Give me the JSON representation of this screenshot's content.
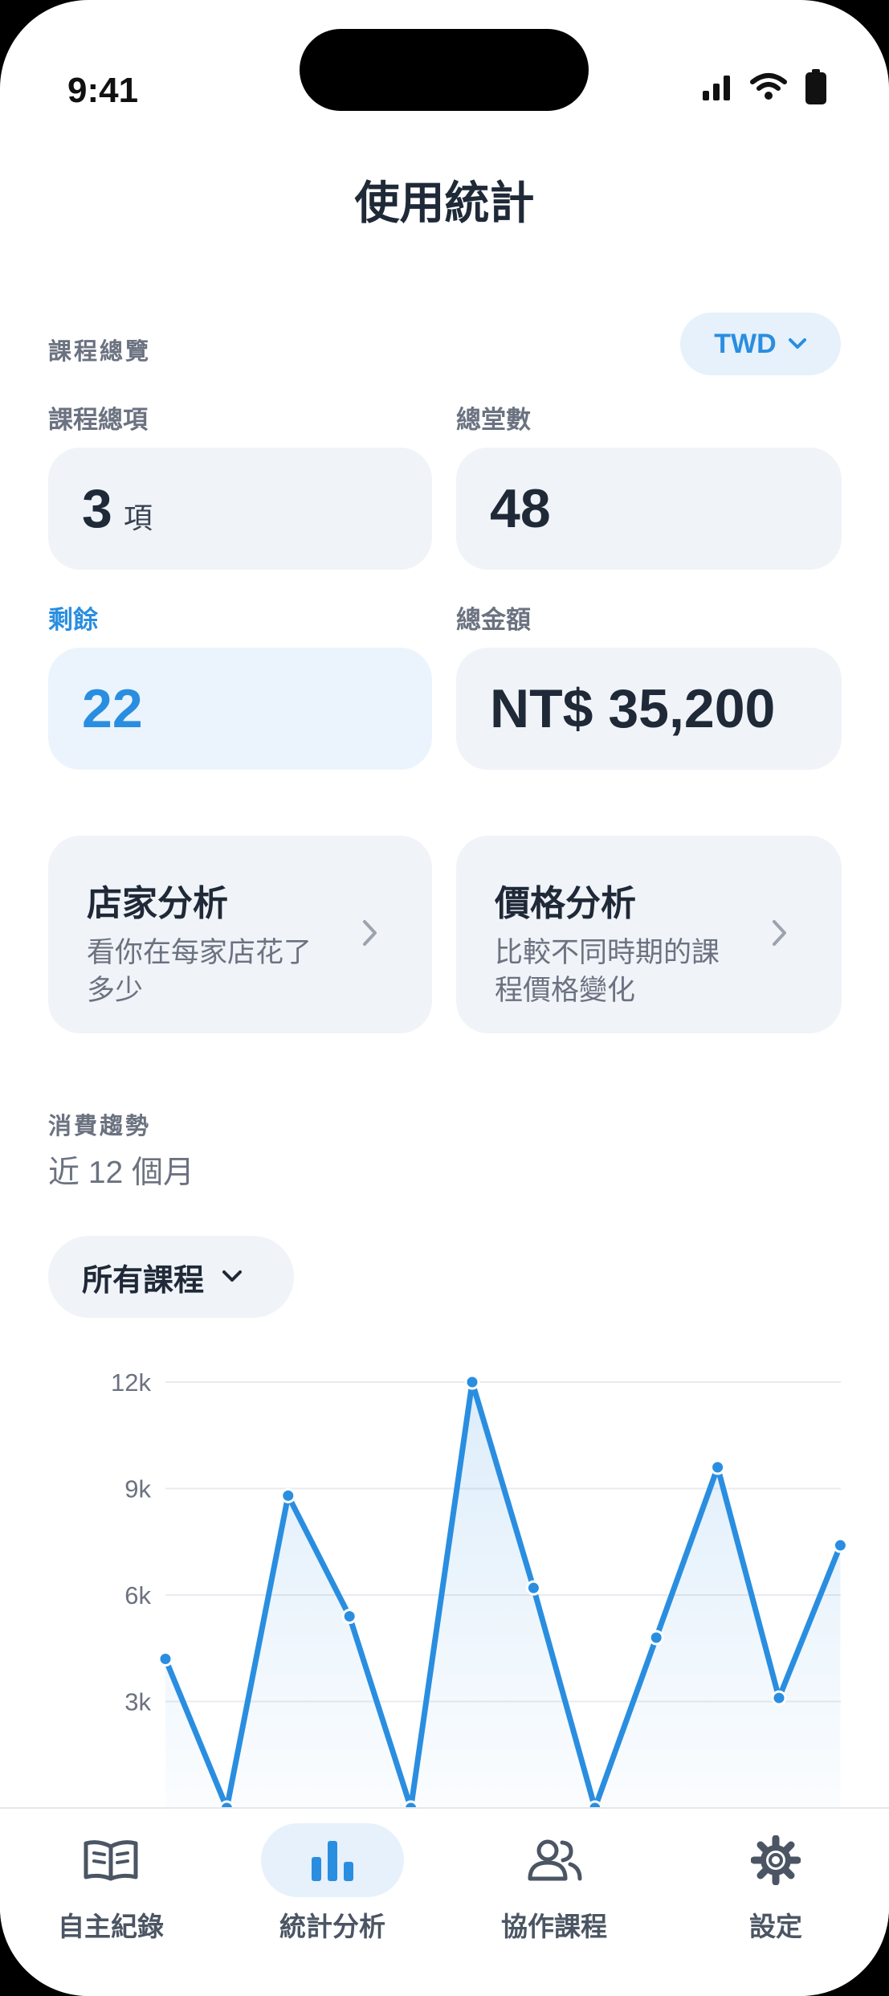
{
  "status_bar": {
    "time": "9:41"
  },
  "header": {
    "title": "使用統計"
  },
  "overview": {
    "section_label": "課程總覽",
    "currency": "TWD",
    "total_courses": {
      "label": "課程總項",
      "value": "3",
      "unit": "項"
    },
    "total_sessions": {
      "label": "總堂數",
      "value": "48"
    },
    "remaining": {
      "label": "剩餘",
      "value": "22"
    },
    "total_amount": {
      "label": "總金額",
      "value": "NT$ 35,200"
    }
  },
  "analysis_cards": [
    {
      "title": "店家分析",
      "description": "看你在每家店花了多少"
    },
    {
      "title": "價格分析",
      "description": "比較不同時期的課程價格變化"
    }
  ],
  "trend": {
    "section_label": "消費趨勢",
    "period": "近 12 個月",
    "filter": "所有課程"
  },
  "chart_data": {
    "type": "area",
    "x": [
      1,
      2,
      3,
      4,
      5,
      6,
      7,
      8,
      9,
      10,
      11,
      12
    ],
    "values": [
      4200,
      0,
      8800,
      5400,
      0,
      12000,
      6200,
      0,
      4800,
      9600,
      3100,
      7400
    ],
    "ylim": [
      0,
      12000
    ],
    "ytick_labels": [
      "12k",
      "9k",
      "6k",
      "3k"
    ],
    "grid": true,
    "color": "#2a8ee0"
  },
  "tabbar": {
    "tabs": [
      {
        "label": "自主紀錄",
        "icon": "book-icon",
        "active": false
      },
      {
        "label": "統計分析",
        "icon": "bar-chart-icon",
        "active": true
      },
      {
        "label": "協作課程",
        "icon": "people-icon",
        "active": false
      },
      {
        "label": "設定",
        "icon": "gear-icon",
        "active": false
      }
    ]
  },
  "colors": {
    "accent": "#2a8ee0",
    "card": "#f0f3f8",
    "accent_card": "#ebf4fd"
  }
}
